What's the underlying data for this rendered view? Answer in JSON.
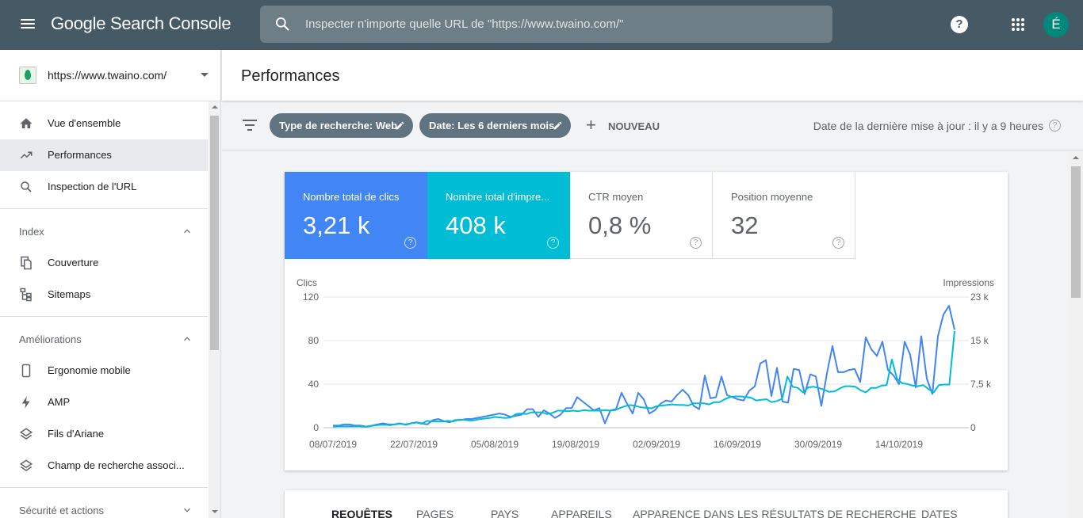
{
  "header": {
    "app_title": "Google Search Console",
    "search_placeholder": "Inspecter n'importe quelle URL de \"https://www.twaino.com/\"",
    "help_label": "?",
    "avatar_initial": "É"
  },
  "sidebar": {
    "property_url": "https://www.twaino.com/",
    "main_items": [
      {
        "label": "Vue d'ensemble",
        "icon": "home-icon"
      },
      {
        "label": "Performances",
        "icon": "trending-up-icon",
        "active": true
      },
      {
        "label": "Inspection de l'URL",
        "icon": "search-icon"
      }
    ],
    "sections": [
      {
        "title": "Index",
        "items": [
          {
            "label": "Couverture",
            "icon": "copy-icon"
          },
          {
            "label": "Sitemaps",
            "icon": "sitemap-icon"
          }
        ]
      },
      {
        "title": "Améliorations",
        "items": [
          {
            "label": "Ergonomie mobile",
            "icon": "smartphone-icon"
          },
          {
            "label": "AMP",
            "icon": "bolt-icon"
          },
          {
            "label": "Fils d'Ariane",
            "icon": "layers-icon"
          },
          {
            "label": "Champ de recherche associ...",
            "icon": "layers-icon"
          }
        ]
      },
      {
        "title": "Sécurité et actions",
        "items": []
      }
    ]
  },
  "page": {
    "title": "Performances",
    "filters": [
      {
        "label": "Type de recherche: Web"
      },
      {
        "label": "Date: Les 6 derniers mois"
      }
    ],
    "new_label": "NOUVEAU",
    "last_update": "Date de la dernière mise à jour : il y a 9 heures",
    "help_label": "?"
  },
  "metrics": [
    {
      "label": "Nombre total de clics",
      "value": "3,21 k",
      "color": "#4285f4",
      "active": true
    },
    {
      "label": "Nombre total d'impre...",
      "value": "408 k",
      "color": "#00bcd4",
      "active": true
    },
    {
      "label": "CTR moyen",
      "value": "0,8 %",
      "active": false
    },
    {
      "label": "Position moyenne",
      "value": "32",
      "active": false
    }
  ],
  "chart_data": {
    "type": "line",
    "y_left_label": "Clics",
    "y_right_label": "Impressions",
    "y_left_ticks": [
      "120",
      "80",
      "40",
      "0"
    ],
    "y_right_ticks": [
      "23 k",
      "15 k",
      "7,5 k",
      "0"
    ],
    "ylim_left": [
      0,
      120
    ],
    "ylim_right": [
      0,
      23000
    ],
    "x_labels": [
      "08/07/2019",
      "22/07/2019",
      "05/08/2019",
      "19/08/2019",
      "02/09/2019",
      "16/09/2019",
      "30/09/2019",
      "14/10/2019"
    ],
    "grid": true,
    "series": [
      {
        "name": "Nombre total de clics",
        "axis": "left",
        "color": "#4285f4",
        "values": [
          2,
          2,
          3,
          3,
          2,
          2,
          1,
          2,
          3,
          4,
          3,
          3,
          4,
          3,
          4,
          5,
          4,
          3,
          7,
          8,
          6,
          5,
          7,
          7,
          8,
          8,
          9,
          10,
          11,
          12,
          13,
          12,
          10,
          11,
          12,
          17,
          17,
          10,
          16,
          13,
          9,
          12,
          18,
          18,
          28,
          24,
          20,
          16,
          18,
          4,
          16,
          17,
          32,
          22,
          13,
          32,
          26,
          13,
          16,
          22,
          25,
          24,
          30,
          35,
          30,
          20,
          17,
          48,
          27,
          28,
          47,
          30,
          28,
          26,
          25,
          34,
          38,
          59,
          62,
          29,
          55,
          24,
          23,
          54,
          53,
          31,
          49,
          47,
          20,
          50,
          75,
          51,
          51,
          53,
          54,
          42,
          83,
          72,
          66,
          79,
          53,
          48,
          40,
          79,
          67,
          37,
          84,
          45,
          31,
          84,
          104,
          112,
          90
        ]
      },
      {
        "name": "Nombre total d'impressions",
        "axis": "right",
        "color": "#00bcd4",
        "values": [
          200,
          230,
          250,
          250,
          250,
          250,
          200,
          250,
          400,
          500,
          500,
          450,
          600,
          700,
          500,
          800,
          900,
          700,
          1200,
          1100,
          1100,
          1100,
          1200,
          1100,
          1400,
          1400,
          1300,
          1300,
          1500,
          1600,
          1700,
          1900,
          1800,
          1700,
          1800,
          2400,
          2500,
          2400,
          2700,
          2700,
          2700,
          2400,
          2600,
          3000,
          3000,
          2900,
          3000,
          2900,
          3100,
          3000,
          3000,
          3000,
          3100,
          3000,
          3100,
          3500,
          3800,
          4000,
          3800,
          3600,
          3500,
          3400,
          3800,
          3900,
          4000,
          4100,
          4000,
          4000,
          3900,
          4300,
          4300,
          4300,
          4100,
          4500,
          4500,
          5000,
          5400,
          5500,
          5500,
          5400,
          5300,
          4800,
          4900,
          5000,
          4500,
          4700,
          5100,
          9000,
          7200,
          7000,
          6200,
          7100,
          7200,
          7000,
          6700,
          6300,
          6400,
          6900,
          7300,
          7300,
          7200,
          6600,
          6200,
          7000,
          7000,
          7400,
          7500,
          12000,
          8600,
          7800,
          7700,
          7400,
          7300,
          7500,
          6800,
          6200,
          7500,
          7600,
          7600,
          17000
        ]
      }
    ]
  },
  "tabs": [
    "REQUÊTES",
    "PAGES",
    "PAYS",
    "APPAREILS",
    "APPARENCE DANS LES RÉSULTATS DE RECHERCHE",
    "DATES"
  ]
}
